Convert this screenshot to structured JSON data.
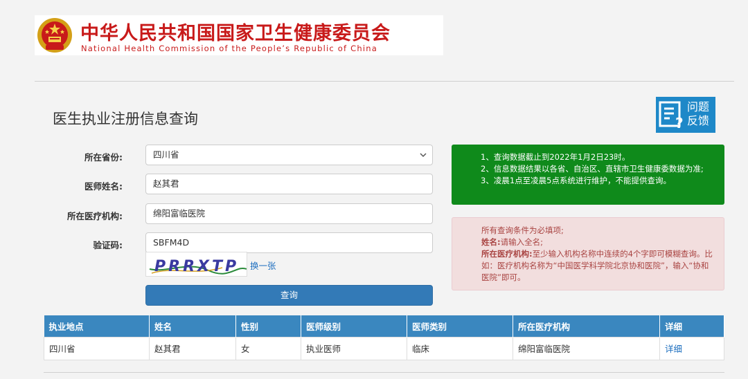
{
  "header": {
    "title": "中华人民共和国国家卫生健康委员会",
    "subtitle": "National Health Commission of the People’s Republic of China",
    "emblem_icon": "national-emblem-icon",
    "brand_color": "#c81a1a"
  },
  "page": {
    "title": "医生执业注册信息查询"
  },
  "feedback": {
    "label": "问题反馈",
    "icon": "feedback-document-icon"
  },
  "form": {
    "province_label": "所在省份:",
    "province_value": "四川省",
    "name_label": "医师姓名:",
    "name_value": "赵其君",
    "institution_label": "所在医疗机构:",
    "institution_value": "绵阳富临医院",
    "captcha_label": "验证码:",
    "captcha_value": "SBFM4D",
    "captcha_image_text": "PRRXTP",
    "change_captcha": "换一张",
    "submit": "查询"
  },
  "notice_green": {
    "lines": [
      "1、查询数据截止到2022年1月2日23时。",
      "2、信息数据结果以各省、自治区、直辖市卫生健康委数据为准;",
      "3、凌晨1点至凌晨5点系统进行维护，不能提供查询。"
    ]
  },
  "notice_red": {
    "line1": "所有查询条件为必填项;",
    "name_key": "姓名:",
    "name_text": "请输入全名;",
    "inst_key": "所在医疗机构:",
    "inst_text": "至少输入机构名称中连续的4个字即可模糊查询。比如：医疗机构名称为“中国医学科学院北京协和医院”，输入“协和医院”即可。"
  },
  "table": {
    "headers": [
      "执业地点",
      "姓名",
      "性别",
      "医师级别",
      "医师类别",
      "所在医疗机构",
      "详细"
    ],
    "row": {
      "location": "四川省",
      "name": "赵其君",
      "gender": "女",
      "level": "执业医师",
      "category": "临床",
      "institution": "绵阳富临医院",
      "detail": "详细"
    }
  },
  "colors": {
    "accent_blue": "#337ab7",
    "table_header": "#3a87bf",
    "notice_green": "#0f8a1b",
    "notice_red_bg": "#f2dede",
    "notice_red_text": "#a94442"
  }
}
